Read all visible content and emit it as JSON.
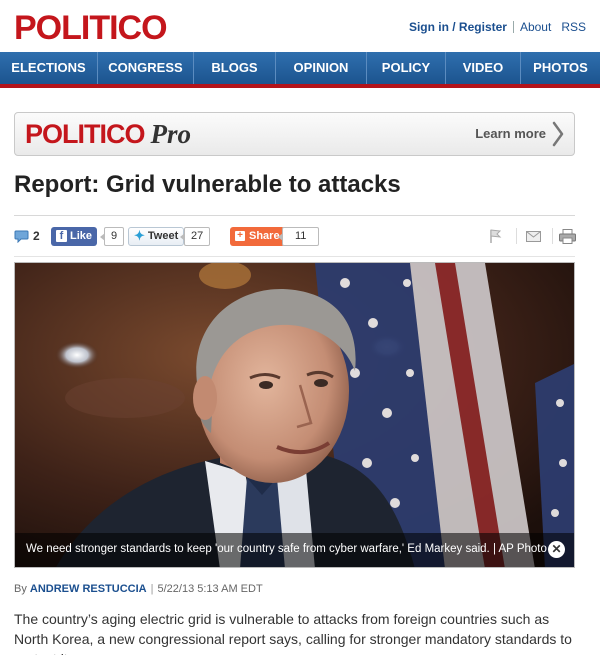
{
  "header": {
    "logo": "POLITICO",
    "signin": "Sign in / Register",
    "about": "About",
    "rss": "RSS"
  },
  "nav": [
    "ELECTIONS",
    "CONGRESS",
    "BLOGS",
    "OPINION",
    "POLICY",
    "VIDEO",
    "PHOTOS"
  ],
  "pro_banner": {
    "logo": "POLITICO",
    "suffix": "Pro",
    "learn_more": "Learn more"
  },
  "article": {
    "headline": "Report: Grid vulnerable to attacks",
    "comment_count": "2",
    "like_label": "Like",
    "like_count": "9",
    "tweet_label": "Tweet",
    "tweet_count": "27",
    "share_label": "Share",
    "share_count": "11",
    "caption": "We need stronger standards to keep 'our country safe from cyber warfare,' Ed Markey said. | AP Photo",
    "byline_prefix": "By",
    "author": "ANDREW RESTUCCIA",
    "timestamp": "5/22/13 5:13 AM EDT",
    "body": "The country’s aging electric grid is vulnerable to attacks from foreign countries such as North Korea, a new congressional report says, calling for stronger mandatory standards to protect it."
  },
  "colors": {
    "brand_red": "#c4161c",
    "nav_blue": "#2f6fae",
    "link_blue": "#1b4f8f"
  },
  "icons": [
    "comment-icon",
    "facebook-icon",
    "twitter-icon",
    "share-plus-icon",
    "flag-icon",
    "email-icon",
    "print-icon",
    "close-icon",
    "chevron-right-icon"
  ]
}
